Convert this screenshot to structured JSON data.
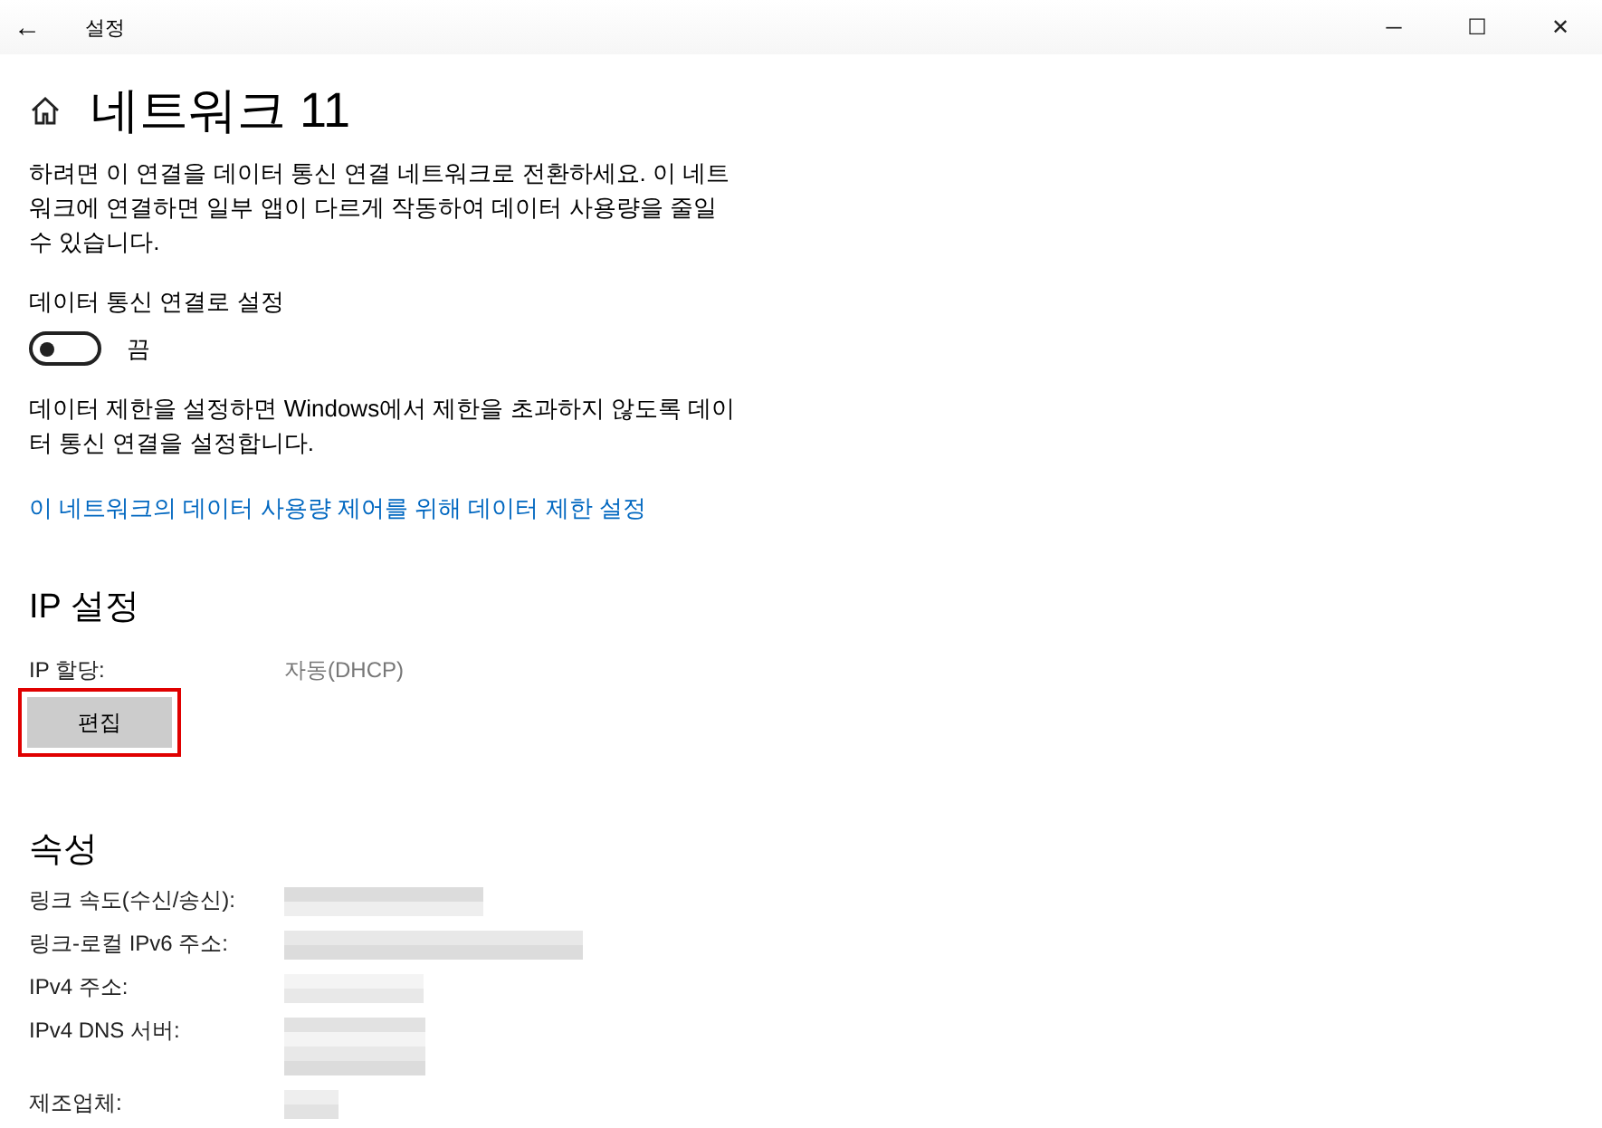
{
  "window": {
    "title": "설정",
    "back": "←",
    "controls": [
      "─",
      "☐",
      "✕"
    ]
  },
  "page": {
    "title": "네트워크 11"
  },
  "intro": "하려면 이 연결을 데이터 통신 연결 네트워크로 전환하세요. 이 네트워크에 연결하면 일부 앱이 다르게 작동하여 데이터 사용량을 줄일 수 있습니다.",
  "metered": {
    "label": "데이터 통신 연결로 설정",
    "on": false,
    "state_text": "끔"
  },
  "limit_text": "데이터 제한을 설정하면 Windows에서 제한을 초과하지 않도록 데이터 통신 연결을 설정합니다.",
  "limit_link": "이 네트워크의 데이터 사용량 제어를 위해 데이터 제한 설정",
  "ip_settings": {
    "heading": "IP 설정",
    "label": "IP 할당:",
    "value": "자동(DHCP)",
    "edit_button": {
      "label": "편집",
      "highlighted": true
    }
  },
  "properties": {
    "heading": "속성",
    "rows": [
      {
        "label": "링크 속도(수신/송신):",
        "kind": "redacted"
      },
      {
        "label": "링크-로컬 IPv6 주소:",
        "kind": "redacted"
      },
      {
        "label": "IPv4 주소:",
        "kind": "redacted"
      },
      {
        "label": "IPv4 DNS 서버:",
        "kind": "redacted_tall"
      },
      {
        "label": "제조업체:",
        "kind": "redacted"
      }
    ]
  }
}
